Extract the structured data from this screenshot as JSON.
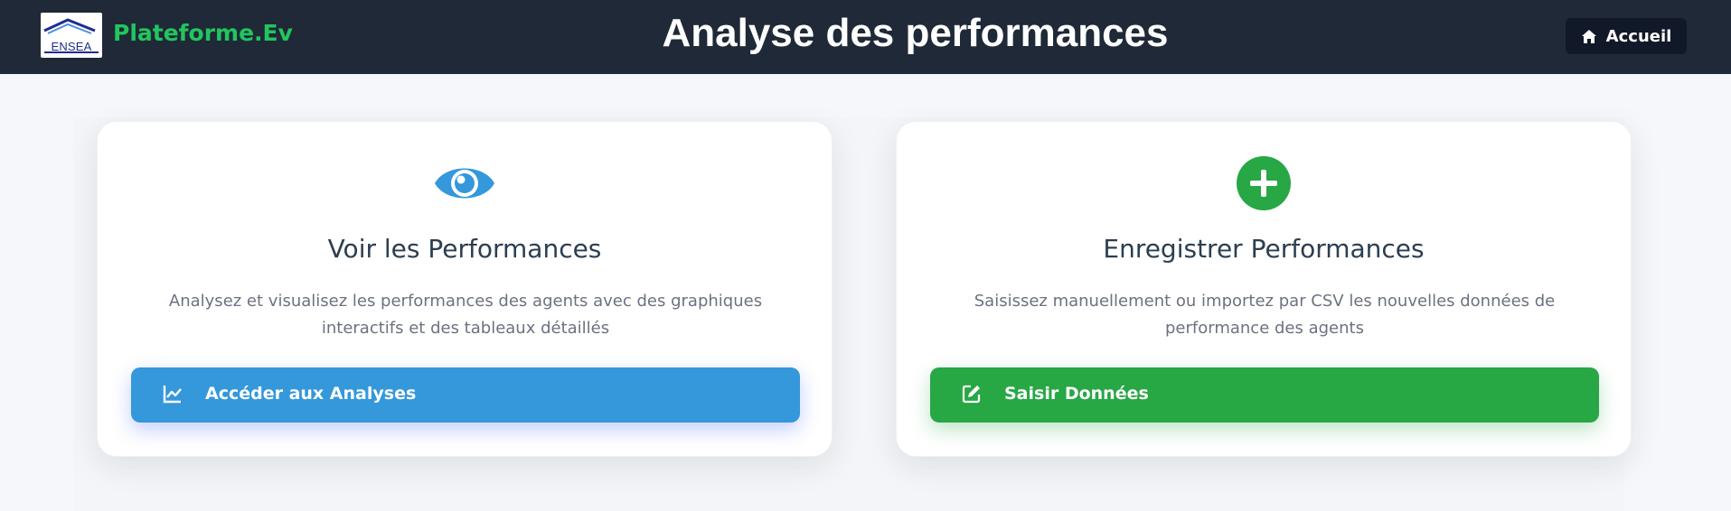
{
  "header": {
    "logo_text": "ENSEA",
    "brand": "Plateforme.Ev",
    "title": "Analyse des performances",
    "home_label": "Accueil"
  },
  "cards": [
    {
      "icon": "eye-icon",
      "icon_color": "#3498db",
      "title": "Voir les Performances",
      "description": "Analysez et visualisez les performances des agents avec des graphiques interactifs et des tableaux détaillés",
      "button_icon": "chart-line-icon",
      "button_label": "Accéder aux Analyses",
      "button_color": "#3498db"
    },
    {
      "icon": "plus-circle-icon",
      "icon_color": "#28a745",
      "title": "Enregistrer Performances",
      "description": "Saisissez manuellement ou importez par CSV les nouvelles données de performance des agents",
      "button_icon": "edit-icon",
      "button_label": "Saisir Données",
      "button_color": "#28a745"
    }
  ],
  "colors": {
    "header_bg": "#1f2937",
    "brand_green": "#22c55e",
    "title_dark": "#2c3e50",
    "desc_gray": "#6b7280"
  }
}
